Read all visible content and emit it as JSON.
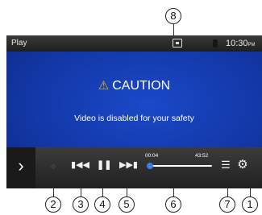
{
  "status_bar": {
    "mode": "Play",
    "clock": "10:30",
    "clock_suffix": "PM",
    "display_icon": "display-mode-icon",
    "bluetooth_icon": "bluetooth-icon"
  },
  "main": {
    "warning_icon": "warning-triangle-icon",
    "caution_title": "CAUTION",
    "message": "Video is disabled for your safety"
  },
  "controls": {
    "panel_toggle_icon": "chevron-right-icon",
    "move_icon": "move-arrows-icon",
    "prev_icon": "skip-previous-icon",
    "pause_icon": "pause-icon",
    "next_icon": "skip-next-icon",
    "elapsed": "00:04",
    "total": "43:52",
    "progress_fraction": 0.0015,
    "list_icon": "list-icon",
    "settings_icon": "gear-icon"
  },
  "callouts": [
    "8",
    "2",
    "3",
    "4",
    "5",
    "6",
    "7",
    "1"
  ],
  "colors": {
    "screen_blue": "#1338a8",
    "progress_accent": "#3a7ee8",
    "warning_yellow": "#f1b400"
  }
}
